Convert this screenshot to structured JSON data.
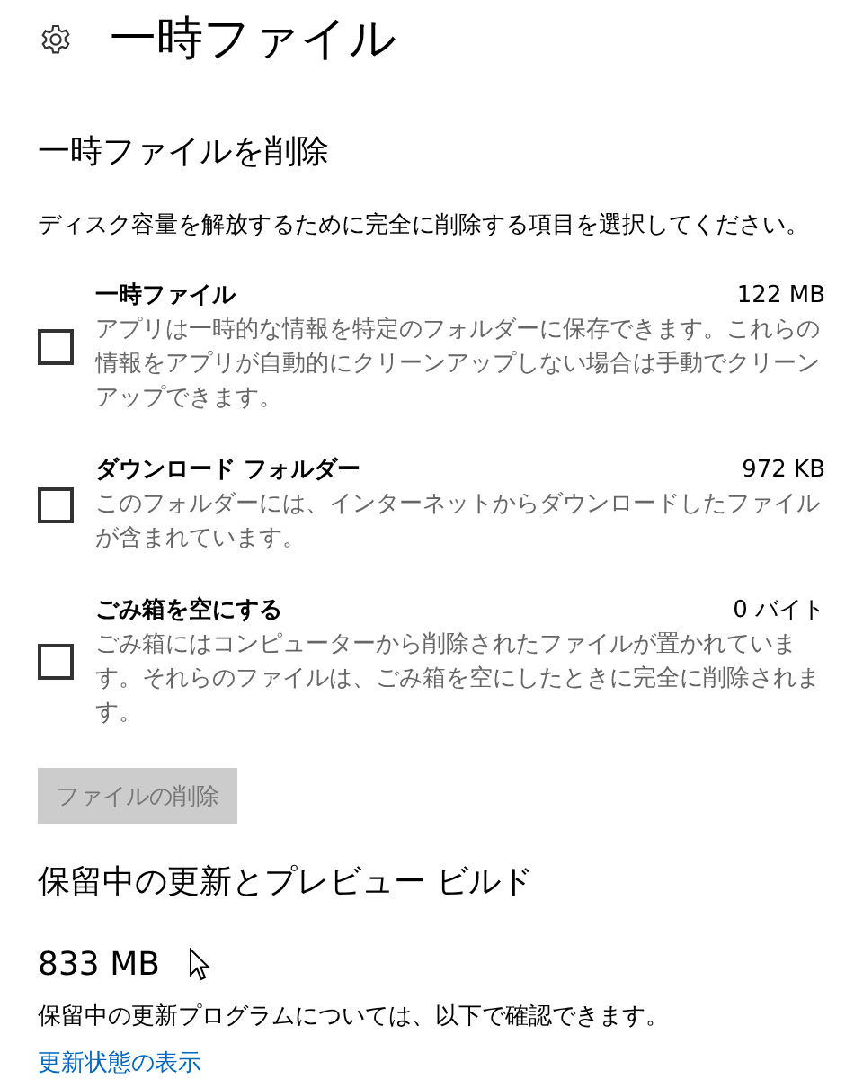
{
  "page": {
    "title": "一時ファイル"
  },
  "cleanup": {
    "heading": "一時ファイルを削除",
    "description": "ディスク容量を解放するために完全に削除する項目を選択してください。",
    "items": [
      {
        "name": "一時ファイル",
        "size": "122 MB",
        "description": "アプリは一時的な情報を特定のフォルダーに保存できます。これらの情報をアプリが自動的にクリーンアップしない場合は手動でクリーンアップできます。",
        "checked": false
      },
      {
        "name": "ダウンロード フォルダー",
        "size": "972 KB",
        "description": "このフォルダーには、インターネットからダウンロードしたファイルが含まれています。",
        "checked": false
      },
      {
        "name": "ごみ箱を空にする",
        "size": "0 バイト",
        "description": "ごみ箱にはコンピューターから削除されたファイルが置かれています。それらのファイルは、ごみ箱を空にしたときに完全に削除されます。",
        "checked": false
      }
    ],
    "delete_button": {
      "label": "ファイルの削除",
      "disabled": true
    }
  },
  "pending": {
    "heading": "保留中の更新とプレビュー ビルド",
    "size": "833 MB",
    "description": "保留中の更新プログラムについては、以下で確認できます。",
    "link": "更新状態の表示"
  }
}
